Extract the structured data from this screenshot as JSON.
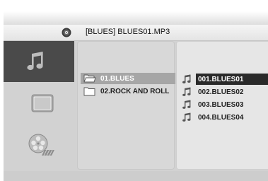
{
  "path": {
    "icon": "disc-icon",
    "current_path": "[BLUES] BLUES01.MP3"
  },
  "sidebar": {
    "items": [
      {
        "icon": "music-note-icon",
        "active": true
      },
      {
        "icon": "photo-frame-icon",
        "active": false
      },
      {
        "icon": "film-reel-icon",
        "active": false
      }
    ]
  },
  "folders": {
    "items": [
      {
        "label": "01.BLUES",
        "icon": "folder-open-icon",
        "selected": true
      },
      {
        "label": "02.ROCK AND ROLL",
        "icon": "folder-icon",
        "selected": false
      }
    ]
  },
  "files": {
    "items": [
      {
        "label": "001.BLUES01",
        "icon": "music-note-icon",
        "selected": true
      },
      {
        "label": "002.BLUES02",
        "icon": "music-note-icon",
        "selected": false
      },
      {
        "label": "003.BLUES03",
        "icon": "music-note-icon",
        "selected": false
      },
      {
        "label": "004.BLUES04",
        "icon": "music-note-icon",
        "selected": false
      }
    ]
  },
  "colors": {
    "background": "#d2d2d2",
    "sidebar_active": "#4a4a4a",
    "file_selected": "#2a2a2a",
    "folder_selected": "#a6a6a6"
  }
}
